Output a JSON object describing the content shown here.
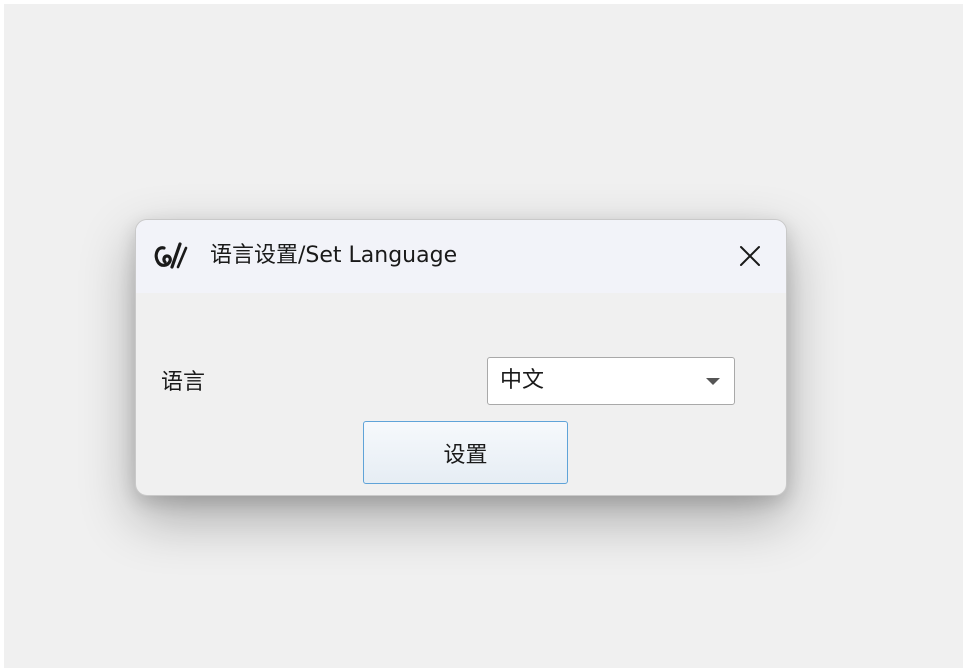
{
  "window": {
    "title": "语言设置/Set Language",
    "icon": "app-logo-icon",
    "close_icon": "close-icon"
  },
  "form": {
    "language_label": "语言",
    "language_select": {
      "selected": "中文",
      "arrow_icon": "dropdown-arrow-icon"
    },
    "submit_label": "设置"
  }
}
